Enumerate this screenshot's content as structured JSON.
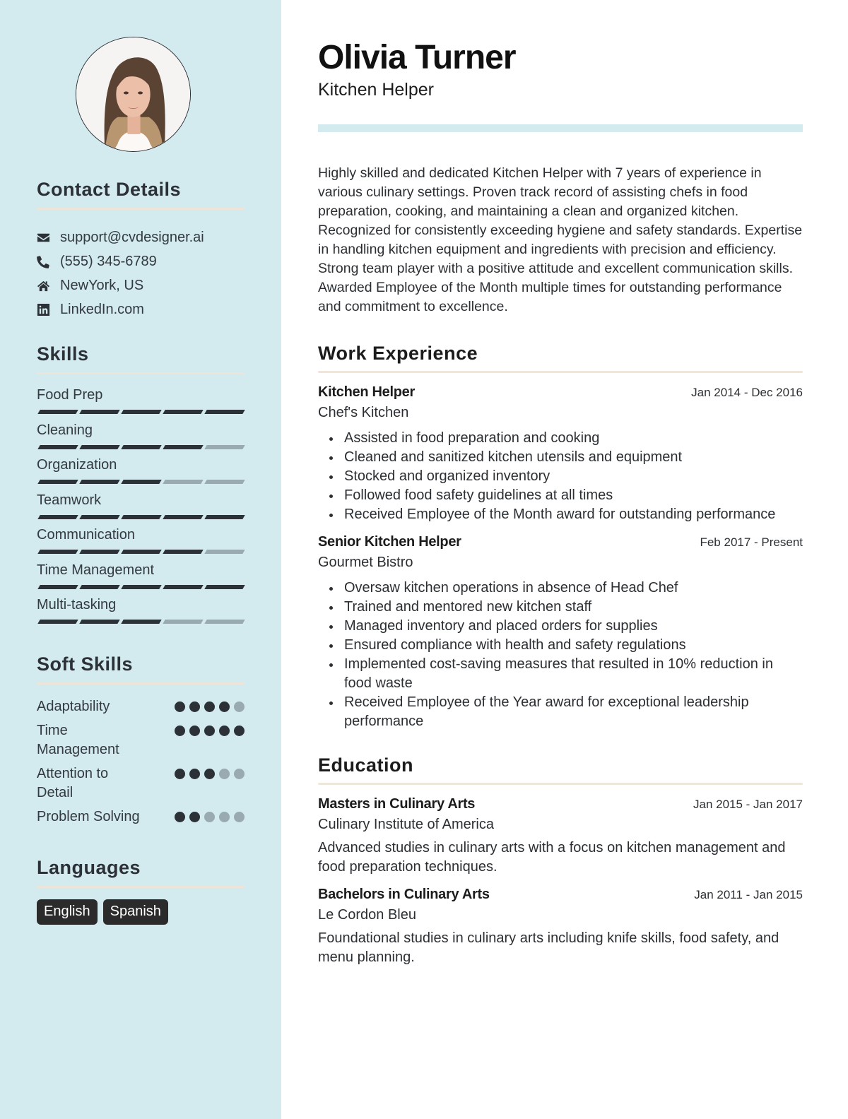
{
  "profile": {
    "name": "Olivia Turner",
    "title": "Kitchen Helper",
    "photo_icon": "profile-photo"
  },
  "colors": {
    "sidebar_bg": "#d3eaee",
    "header_band": "#d3eaee",
    "text_dark": "#2b3136",
    "skill_filled": "#2b3136",
    "skill_empty": "#99aab0",
    "badge_bg": "#2b2b2b",
    "rule_peach": "#f3e4d4",
    "rule_beige": "#ece7d9"
  },
  "contact": {
    "heading": "Contact Details",
    "items": [
      {
        "icon": "envelope-icon",
        "text": "support@cvdesigner.ai"
      },
      {
        "icon": "phone-icon",
        "text": "(555) 345-6789"
      },
      {
        "icon": "home-icon",
        "text": "NewYork, US"
      },
      {
        "icon": "linkedin-icon",
        "text": "LinkedIn.com"
      }
    ]
  },
  "skills": {
    "heading": "Skills",
    "max": 5,
    "items": [
      {
        "label": "Food Prep",
        "level": 5
      },
      {
        "label": "Cleaning",
        "level": 4
      },
      {
        "label": "Organization",
        "level": 3
      },
      {
        "label": "Teamwork",
        "level": 5
      },
      {
        "label": "Communication",
        "level": 4
      },
      {
        "label": "Time Management",
        "level": 5
      },
      {
        "label": "Multi-tasking",
        "level": 3
      }
    ]
  },
  "soft_skills": {
    "heading": "Soft Skills",
    "max": 5,
    "items": [
      {
        "label": "Adaptability",
        "level": 4
      },
      {
        "label": "Time Management",
        "level": 5
      },
      {
        "label": "Attention to Detail",
        "level": 3
      },
      {
        "label": "Problem Solving",
        "level": 2
      }
    ]
  },
  "languages": {
    "heading": "Languages",
    "items": [
      "English",
      "Spanish"
    ]
  },
  "summary": "Highly skilled and dedicated Kitchen Helper with 7 years of experience in various culinary settings. Proven track record of assisting chefs in food preparation, cooking, and maintaining a clean and organized kitchen. Recognized for consistently exceeding hygiene and safety standards. Expertise in handling kitchen equipment and ingredients with precision and efficiency. Strong team player with a positive attitude and excellent communication skills. Awarded Employee of the Month multiple times for outstanding performance and commitment to excellence.",
  "work": {
    "heading": "Work Experience",
    "entries": [
      {
        "title": "Kitchen Helper",
        "date": "Jan 2014 - Dec 2016",
        "org": "Chef's Kitchen",
        "bullets": [
          "Assisted in food preparation and cooking",
          "Cleaned and sanitized kitchen utensils and equipment",
          "Stocked and organized inventory",
          "Followed food safety guidelines at all times",
          "Received Employee of the Month award for outstanding performance"
        ]
      },
      {
        "title": "Senior Kitchen Helper",
        "date": "Feb 2017 - Present",
        "org": "Gourmet Bistro",
        "bullets": [
          "Oversaw kitchen operations in absence of Head Chef",
          "Trained and mentored new kitchen staff",
          "Managed inventory and placed orders for supplies",
          "Ensured compliance with health and safety regulations",
          "Implemented cost-saving measures that resulted in 10% reduction in food waste",
          "Received Employee of the Year award for exceptional leadership performance"
        ]
      }
    ]
  },
  "education": {
    "heading": "Education",
    "entries": [
      {
        "title": "Masters in Culinary Arts",
        "date": "Jan 2015 - Jan 2017",
        "org": "Culinary Institute of America",
        "desc": "Advanced studies in culinary arts with a focus on kitchen management and food preparation techniques."
      },
      {
        "title": "Bachelors in Culinary Arts",
        "date": "Jan 2011 - Jan 2015",
        "org": "Le Cordon Bleu",
        "desc": "Foundational studies in culinary arts including knife skills, food safety, and menu planning."
      }
    ]
  }
}
